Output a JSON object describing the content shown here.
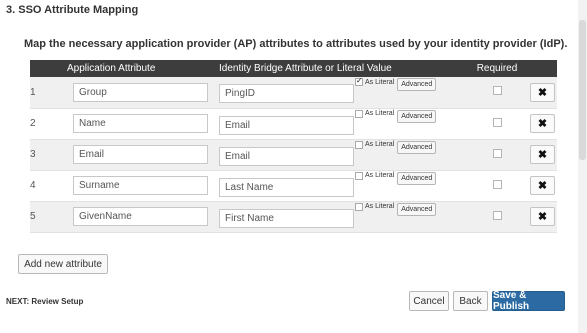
{
  "section": {
    "title": "3. SSO Attribute Mapping"
  },
  "description": "Map the necessary application provider (AP) attributes to attributes used by your identity provider (IdP).",
  "table": {
    "headers": {
      "application": "Application Attribute",
      "identity": "Identity Bridge Attribute or Literal Value",
      "required": "Required"
    },
    "as_literal_label": "As Literal",
    "advanced_label": "Advanced",
    "rows": [
      {
        "num": "1",
        "app": "Group",
        "idp": "PingID",
        "literal": true
      },
      {
        "num": "2",
        "app": "Name",
        "idp": "Email",
        "literal": false
      },
      {
        "num": "3",
        "app": "Email",
        "idp": "Email",
        "literal": false
      },
      {
        "num": "4",
        "app": "Surname",
        "idp": "Last Name",
        "literal": false
      },
      {
        "num": "5",
        "app": "GivenName",
        "idp": "First Name",
        "literal": false
      }
    ]
  },
  "add_label": "Add new attribute",
  "footer": {
    "next_label": "NEXT: Review Setup",
    "cancel_label": "Cancel",
    "back_label": "Back",
    "publish_label": "Save & Publish"
  },
  "colors": {
    "header_bg": "#3d3d3d",
    "primary": "#2b6aa3"
  },
  "icons": {
    "delete": "close-x-icon",
    "checkbox": "checkbox-icon"
  }
}
